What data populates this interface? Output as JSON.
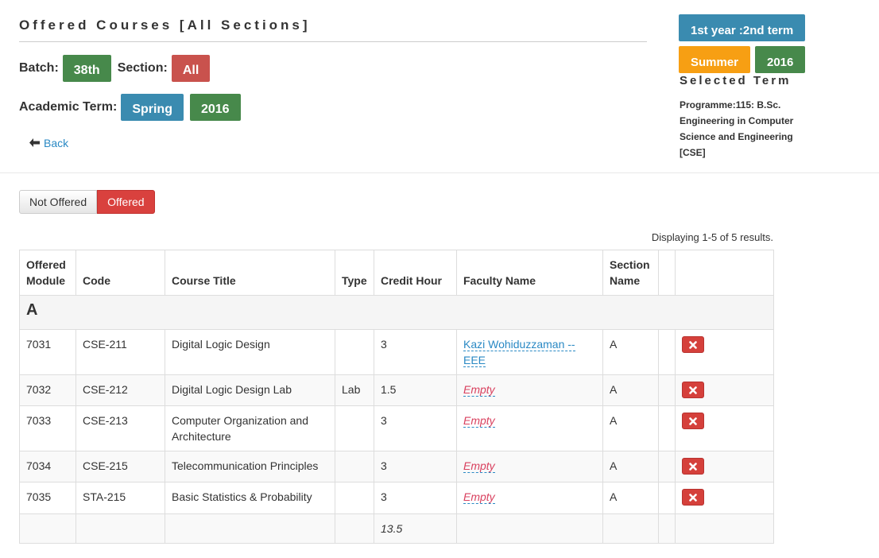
{
  "header": {
    "title": "Offered Courses [All Sections]",
    "batch_label": "Batch:",
    "batch_value": "38th",
    "section_label": "Section:",
    "section_value": "All",
    "term_label": "Academic Term:",
    "term_season": "Spring",
    "term_year": "2016",
    "back_label": "Back"
  },
  "selected_term": {
    "year_term": "1st year :2nd term",
    "season": "Summer",
    "year": "2016",
    "heading": "Selected Term",
    "programme": "Programme:115: B.Sc. Engineering in Computer Science and Engineering [CSE]"
  },
  "toggle": {
    "not_offered_label": "Not Offered",
    "offered_label": "Offered"
  },
  "summary": "Displaying 1-5 of 5 results.",
  "table": {
    "headers": {
      "offered_module": "Offered Module",
      "code": "Code",
      "course_title": "Course Title",
      "type": "Type",
      "credit_hour": "Credit Hour",
      "faculty_name": "Faculty Name",
      "section_name": "Section Name"
    },
    "group": "A",
    "rows": [
      {
        "module": "7031",
        "code": "CSE-211",
        "title": "Digital Logic Design",
        "type": "",
        "credit": "3",
        "faculty": "Kazi Wohiduzzaman -- EEE",
        "section": "A"
      },
      {
        "module": "7032",
        "code": "CSE-212",
        "title": "Digital Logic Design Lab",
        "type": "Lab",
        "credit": "1.5",
        "faculty": "Empty",
        "section": "A"
      },
      {
        "module": "7033",
        "code": "CSE-213",
        "title": "Computer Organization and Architecture",
        "type": "",
        "credit": "3",
        "faculty": "Empty",
        "section": "A"
      },
      {
        "module": "7034",
        "code": "CSE-215",
        "title": "Telecommunication Principles",
        "type": "",
        "credit": "3",
        "faculty": "Empty",
        "section": "A"
      },
      {
        "module": "7035",
        "code": "STA-215",
        "title": "Basic Statistics & Probability",
        "type": "",
        "credit": "3",
        "faculty": "Empty",
        "section": "A"
      }
    ],
    "total_credit": "13.5"
  },
  "colors": {
    "green": "#47894b",
    "red": "#c9524d",
    "blue": "#3a8bb0",
    "orange": "#f79f13",
    "link": "#2a89c4",
    "empty": "#d9415f",
    "delete": "#d5403b"
  },
  "icons": {
    "back": "arrow-left-icon",
    "delete": "remove-icon"
  }
}
